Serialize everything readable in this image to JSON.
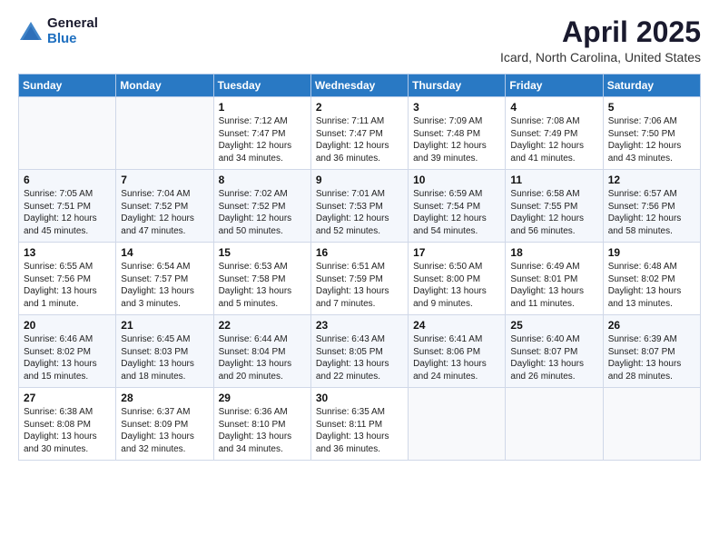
{
  "header": {
    "logo_general": "General",
    "logo_blue": "Blue",
    "title": "April 2025",
    "location": "Icard, North Carolina, United States"
  },
  "weekdays": [
    "Sunday",
    "Monday",
    "Tuesday",
    "Wednesday",
    "Thursday",
    "Friday",
    "Saturday"
  ],
  "weeks": [
    [
      {
        "day": "",
        "info": ""
      },
      {
        "day": "",
        "info": ""
      },
      {
        "day": "1",
        "info": "Sunrise: 7:12 AM\nSunset: 7:47 PM\nDaylight: 12 hours\nand 34 minutes."
      },
      {
        "day": "2",
        "info": "Sunrise: 7:11 AM\nSunset: 7:47 PM\nDaylight: 12 hours\nand 36 minutes."
      },
      {
        "day": "3",
        "info": "Sunrise: 7:09 AM\nSunset: 7:48 PM\nDaylight: 12 hours\nand 39 minutes."
      },
      {
        "day": "4",
        "info": "Sunrise: 7:08 AM\nSunset: 7:49 PM\nDaylight: 12 hours\nand 41 minutes."
      },
      {
        "day": "5",
        "info": "Sunrise: 7:06 AM\nSunset: 7:50 PM\nDaylight: 12 hours\nand 43 minutes."
      }
    ],
    [
      {
        "day": "6",
        "info": "Sunrise: 7:05 AM\nSunset: 7:51 PM\nDaylight: 12 hours\nand 45 minutes."
      },
      {
        "day": "7",
        "info": "Sunrise: 7:04 AM\nSunset: 7:52 PM\nDaylight: 12 hours\nand 47 minutes."
      },
      {
        "day": "8",
        "info": "Sunrise: 7:02 AM\nSunset: 7:52 PM\nDaylight: 12 hours\nand 50 minutes."
      },
      {
        "day": "9",
        "info": "Sunrise: 7:01 AM\nSunset: 7:53 PM\nDaylight: 12 hours\nand 52 minutes."
      },
      {
        "day": "10",
        "info": "Sunrise: 6:59 AM\nSunset: 7:54 PM\nDaylight: 12 hours\nand 54 minutes."
      },
      {
        "day": "11",
        "info": "Sunrise: 6:58 AM\nSunset: 7:55 PM\nDaylight: 12 hours\nand 56 minutes."
      },
      {
        "day": "12",
        "info": "Sunrise: 6:57 AM\nSunset: 7:56 PM\nDaylight: 12 hours\nand 58 minutes."
      }
    ],
    [
      {
        "day": "13",
        "info": "Sunrise: 6:55 AM\nSunset: 7:56 PM\nDaylight: 13 hours\nand 1 minute."
      },
      {
        "day": "14",
        "info": "Sunrise: 6:54 AM\nSunset: 7:57 PM\nDaylight: 13 hours\nand 3 minutes."
      },
      {
        "day": "15",
        "info": "Sunrise: 6:53 AM\nSunset: 7:58 PM\nDaylight: 13 hours\nand 5 minutes."
      },
      {
        "day": "16",
        "info": "Sunrise: 6:51 AM\nSunset: 7:59 PM\nDaylight: 13 hours\nand 7 minutes."
      },
      {
        "day": "17",
        "info": "Sunrise: 6:50 AM\nSunset: 8:00 PM\nDaylight: 13 hours\nand 9 minutes."
      },
      {
        "day": "18",
        "info": "Sunrise: 6:49 AM\nSunset: 8:01 PM\nDaylight: 13 hours\nand 11 minutes."
      },
      {
        "day": "19",
        "info": "Sunrise: 6:48 AM\nSunset: 8:02 PM\nDaylight: 13 hours\nand 13 minutes."
      }
    ],
    [
      {
        "day": "20",
        "info": "Sunrise: 6:46 AM\nSunset: 8:02 PM\nDaylight: 13 hours\nand 15 minutes."
      },
      {
        "day": "21",
        "info": "Sunrise: 6:45 AM\nSunset: 8:03 PM\nDaylight: 13 hours\nand 18 minutes."
      },
      {
        "day": "22",
        "info": "Sunrise: 6:44 AM\nSunset: 8:04 PM\nDaylight: 13 hours\nand 20 minutes."
      },
      {
        "day": "23",
        "info": "Sunrise: 6:43 AM\nSunset: 8:05 PM\nDaylight: 13 hours\nand 22 minutes."
      },
      {
        "day": "24",
        "info": "Sunrise: 6:41 AM\nSunset: 8:06 PM\nDaylight: 13 hours\nand 24 minutes."
      },
      {
        "day": "25",
        "info": "Sunrise: 6:40 AM\nSunset: 8:07 PM\nDaylight: 13 hours\nand 26 minutes."
      },
      {
        "day": "26",
        "info": "Sunrise: 6:39 AM\nSunset: 8:07 PM\nDaylight: 13 hours\nand 28 minutes."
      }
    ],
    [
      {
        "day": "27",
        "info": "Sunrise: 6:38 AM\nSunset: 8:08 PM\nDaylight: 13 hours\nand 30 minutes."
      },
      {
        "day": "28",
        "info": "Sunrise: 6:37 AM\nSunset: 8:09 PM\nDaylight: 13 hours\nand 32 minutes."
      },
      {
        "day": "29",
        "info": "Sunrise: 6:36 AM\nSunset: 8:10 PM\nDaylight: 13 hours\nand 34 minutes."
      },
      {
        "day": "30",
        "info": "Sunrise: 6:35 AM\nSunset: 8:11 PM\nDaylight: 13 hours\nand 36 minutes."
      },
      {
        "day": "",
        "info": ""
      },
      {
        "day": "",
        "info": ""
      },
      {
        "day": "",
        "info": ""
      }
    ]
  ]
}
